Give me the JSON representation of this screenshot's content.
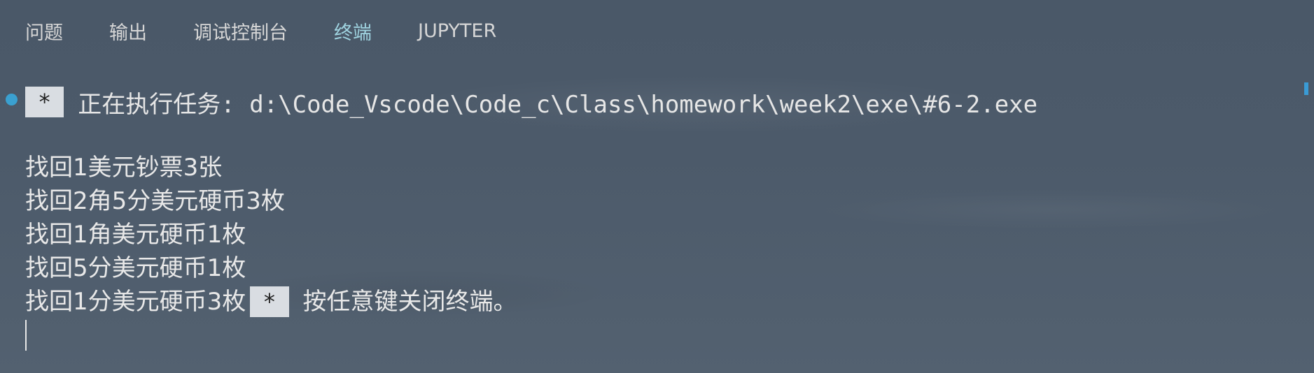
{
  "tabs": [
    {
      "label": "问题",
      "active": false
    },
    {
      "label": "输出",
      "active": false
    },
    {
      "label": "调试控制台",
      "active": false
    },
    {
      "label": "终端",
      "active": true
    },
    {
      "label": "JUPYTER",
      "active": false
    }
  ],
  "terminal": {
    "task_badge": "*",
    "task_text": "正在执行任务: d:\\Code_Vscode\\Code_c\\Class\\homework\\week2\\exe\\#6-2.exe",
    "output_lines": [
      "找回1美元钞票3张",
      "找回2角5分美元硬币3枚",
      "找回1角美元硬币1枚",
      "找回5分美元硬币1枚",
      "找回1分美元硬币3枚"
    ],
    "close_badge": "*",
    "close_text": "按任意键关闭终端。"
  },
  "colors": {
    "active_tab": "#9fd3e0",
    "status_dot": "#3aa0d0",
    "badge_bg": "#d9dde2"
  }
}
